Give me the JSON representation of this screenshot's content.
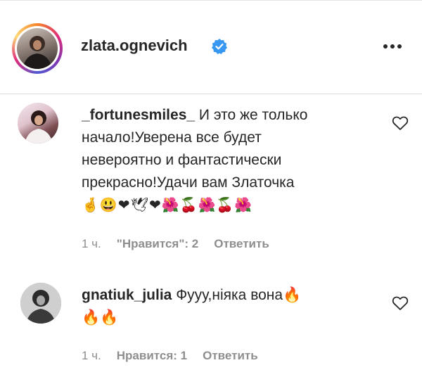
{
  "post_header": {
    "username": "zlata.ognevich",
    "verified_icon": "verified-badge-icon",
    "more_icon": "more-horizontal-icon"
  },
  "comments": [
    {
      "username": "_fortunesmiles_",
      "text_line1": " И это же только",
      "text_lines": [
        "начало!Уверена все будет",
        "невероятно и фантастически",
        "прекрасно!Удачи вам Златочка"
      ],
      "emoji": "🤞😃❤🕊❤🌺🍒🌺🍒🌺",
      "time": "1 ч.",
      "likes": "\"Нравится\": 2",
      "reply": "Ответить"
    },
    {
      "username": "gnatiuk_julia",
      "text_line1": " Фууу,ніяка вона🔥",
      "text_lines": [
        "🔥🔥"
      ],
      "time": "1 ч.",
      "likes": "Нравится: 1",
      "reply": "Ответить"
    }
  ],
  "icons": {
    "like": "heart-outline-icon"
  }
}
